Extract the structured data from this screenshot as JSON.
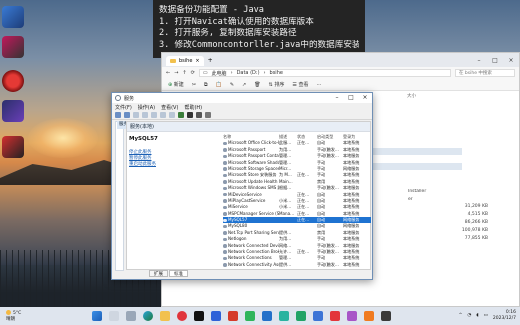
{
  "notes": {
    "title": "数据备份功能配置 - Java",
    "lines": [
      "1. 打开Navicat确认使用的数据库版本",
      "2. 打开服务, 复制数据库安装路径",
      "3. 修改Commoncontorller.java中的数据库安装路径"
    ]
  },
  "explorer": {
    "tab_title": "bsihe",
    "path": [
      "此电脑",
      "Data (D:)",
      "bsihe"
    ],
    "search_placeholder": "在 bsihe 中搜索",
    "toolbar": [
      "新建",
      "排序",
      "查看"
    ],
    "col_size": "大小",
    "partial_names": [
      "Installer",
      "er"
    ],
    "sizes": [
      "31,209 KB",
      "4,515 KB",
      "86,266 KB",
      "100,978 KB",
      "77,855 KB"
    ]
  },
  "services": {
    "title": "服务",
    "menu": [
      "文件(F)",
      "操作(A)",
      "查看(V)",
      "帮助(H)"
    ],
    "tree_root": "服务(本地)",
    "header": "服务(本地)",
    "selected_name": "MySQL57",
    "links": [
      "停止此服务",
      "暂停此服务",
      "重启动此服务"
    ],
    "columns": [
      "名称",
      "描述",
      "状态",
      "启动类型",
      "登录为"
    ],
    "rows": [
      {
        "name": "Microsoft Office Click-to-R...",
        "desc": "此服...",
        "status": "正在...",
        "start": "自动",
        "logon": "本地系统"
      },
      {
        "name": "Microsoft Passport",
        "desc": "为用...",
        "status": "",
        "start": "手动(触发...",
        "logon": "本地系统"
      },
      {
        "name": "Microsoft Passport Container",
        "desc": "管理...",
        "status": "",
        "start": "手动(触发...",
        "logon": "本地服务"
      },
      {
        "name": "Microsoft Software Shado...",
        "desc": "管理...",
        "status": "",
        "start": "手动",
        "logon": "本地系统"
      },
      {
        "name": "Microsoft Storage Spaces S...",
        "desc": "Micr...",
        "status": "",
        "start": "手动",
        "logon": "网络服务"
      },
      {
        "name": "Microsoft Store 安装服务",
        "desc": "为 M...",
        "status": "正在...",
        "start": "手动",
        "logon": "本地系统"
      },
      {
        "name": "Microsoft Update Health S...",
        "desc": "Main...",
        "status": "",
        "start": "禁用",
        "logon": "本地系统"
      },
      {
        "name": "Microsoft Windows SMS 路...",
        "desc": "根据...",
        "status": "",
        "start": "手动(触发...",
        "logon": "本地服务"
      },
      {
        "name": "MiDeviceService",
        "desc": "",
        "status": "正在...",
        "start": "自动",
        "logon": "本地系统"
      },
      {
        "name": "MiPlayCastService",
        "desc": "小米...",
        "status": "正在...",
        "start": "自动",
        "logon": "本地系统"
      },
      {
        "name": "MiService",
        "desc": "小米...",
        "status": "正在...",
        "start": "自动",
        "logon": "本地系统"
      },
      {
        "name": "MSPCManager Service (St...",
        "desc": "Mana...",
        "status": "正在...",
        "start": "自动",
        "logon": "本地系统"
      },
      {
        "name": "MySQL57",
        "desc": "",
        "status": "正在...",
        "start": "自动",
        "logon": "网络服务"
      },
      {
        "name": "MySQL80",
        "desc": "",
        "status": "",
        "start": "自动",
        "logon": "网络服务"
      },
      {
        "name": "Net.Tcp Port Sharing Service",
        "desc": "提供...",
        "status": "",
        "start": "禁用",
        "logon": "本地服务"
      },
      {
        "name": "Netlogon",
        "desc": "为用...",
        "status": "",
        "start": "手动",
        "logon": "本地系统"
      },
      {
        "name": "Network Connected Devi...",
        "desc": "网络...",
        "status": "",
        "start": "手动(触发...",
        "logon": "本地服务"
      },
      {
        "name": "Network Connection Broker",
        "desc": "允许...",
        "status": "正在...",
        "start": "手动(触发...",
        "logon": "本地系统"
      },
      {
        "name": "Network Connections",
        "desc": "管理...",
        "status": "",
        "start": "手动",
        "logon": "本地系统"
      },
      {
        "name": "Network Connectivity Assi...",
        "desc": "提供...",
        "status": "",
        "start": "手动(触发...",
        "logon": "本地系统"
      }
    ],
    "selected_index": 12,
    "tabs": [
      "扩展",
      "标准"
    ]
  },
  "taskbar": {
    "weather_temp": "5°C",
    "weather_text": "晴朗",
    "time": "0:16",
    "date": "2023/12/7"
  },
  "colors": {
    "accent": "#1f73d1",
    "link": "#1a5fb4",
    "notes_bg": "#242424"
  }
}
